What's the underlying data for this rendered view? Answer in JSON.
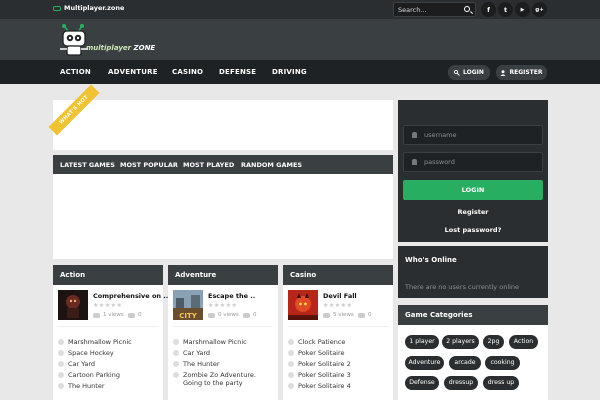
{
  "topbar": {
    "site_name": "Multiplayer.zone",
    "search_placeholder": "Search...",
    "social": [
      {
        "icon": "facebook-icon",
        "glyph": "f"
      },
      {
        "icon": "twitter-icon",
        "glyph": "t"
      },
      {
        "icon": "youtube-icon",
        "glyph": "▶"
      },
      {
        "icon": "google-plus-icon",
        "glyph": "g+"
      }
    ]
  },
  "logo": {
    "word1": "multiplayer",
    "word2": "ZONE"
  },
  "nav": {
    "items": [
      "ACTION",
      "ADVENTURE",
      "CASINO",
      "DEFENSE",
      "DRIVING"
    ],
    "login": "LOGIN",
    "register": "REGISTER"
  },
  "featured": {
    "ribbon": "WHAT'S HOT"
  },
  "tabs": [
    "LATEST GAMES",
    "MOST POPULAR",
    "MOST PLAYED",
    "RANDOM GAMES"
  ],
  "categories": [
    {
      "title": "Action",
      "featured": {
        "name": "Comprehensive on ..",
        "views": "1 views",
        "comments": "0"
      },
      "games": [
        "Marshmallow Picnic",
        "Space Hockey",
        "Car Yard",
        "Cartoon Parking",
        "The Hunter"
      ]
    },
    {
      "title": "Adventure",
      "featured": {
        "name": "Escape the ..",
        "views": "0 views",
        "comments": "0"
      },
      "games": [
        "Marshmallow Picnic",
        "Car Yard",
        "The Hunter",
        "Zombie Zo Adventure. Going to the party"
      ]
    },
    {
      "title": "Casino",
      "featured": {
        "name": "Devil Fall",
        "views": "5 views",
        "comments": "0"
      },
      "games": [
        "Clock Patience",
        "Poker Solitaire",
        "Poker Solitaire 2",
        "Poker Solitaire 3",
        "Poker Solitaire 4"
      ]
    }
  ],
  "sidebar": {
    "username_placeholder": "username",
    "password_placeholder": "password",
    "login_button": "LOGIN",
    "register_link": "Register",
    "lost_password_link": "Lost password?",
    "whos_online": {
      "title": "Who's Online",
      "text": "There are no users currently online"
    },
    "game_categories": {
      "title": "Game Categories",
      "tags": [
        "1 player",
        "2 players",
        "2pg",
        "Action",
        "Adventure",
        "arcade",
        "cooking",
        "Defense",
        "dressup",
        "dress up"
      ]
    }
  },
  "colors": {
    "accent": "#27ae60",
    "ribbon": "#f1c232",
    "dark": "#2b2e30",
    "header": "#3a3f42"
  }
}
